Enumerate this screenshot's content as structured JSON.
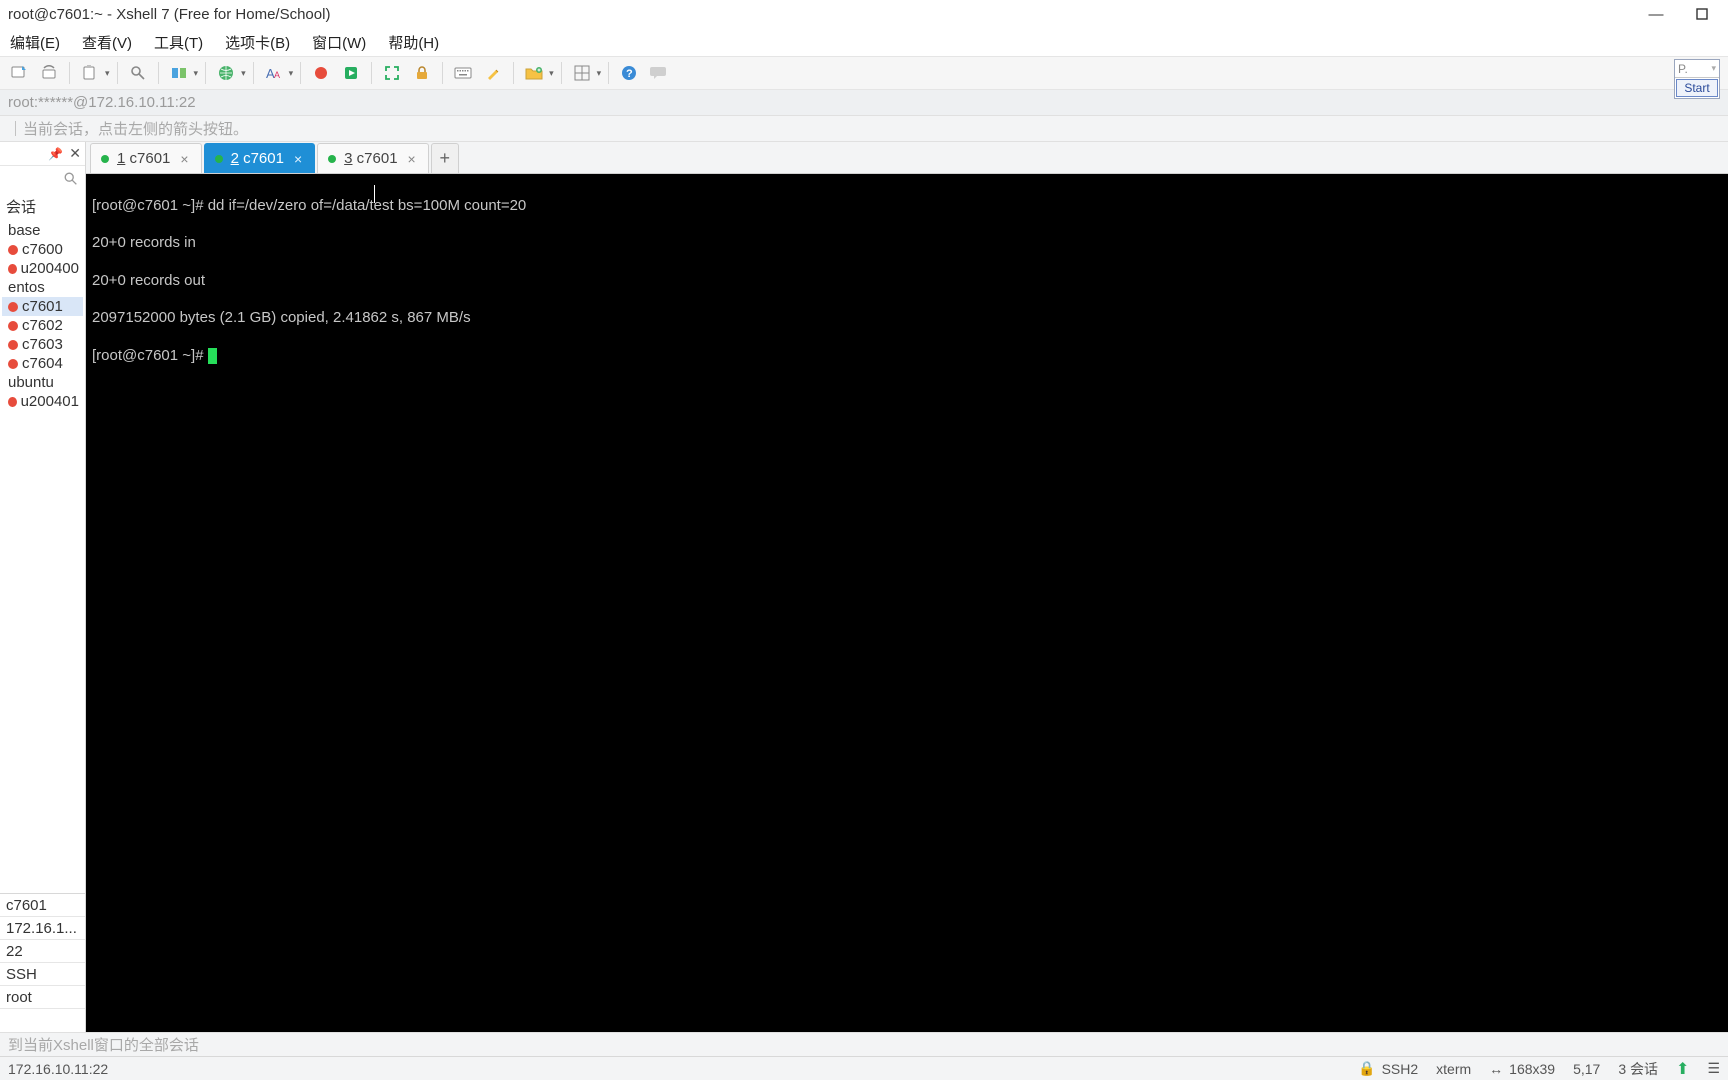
{
  "title": "root@c7601:~ - Xshell 7 (Free for Home/School)",
  "menu": {
    "edit": "编辑(E)",
    "view": "查看(V)",
    "tools": "工具(T)",
    "tabs": "选项卡(B)",
    "window": "窗口(W)",
    "help": "帮助(H)"
  },
  "addr": "root:******@172.16.10.11:22",
  "hint": "｜当前会话，点击左侧的箭头按钮。",
  "start_panel": {
    "row": "P.",
    "button": "Start"
  },
  "sidebar": {
    "title": "会话",
    "groups": {
      "base": "base",
      "centos": "entos",
      "ubuntu": "ubuntu"
    },
    "items_base": [
      {
        "name": "c7600",
        "dot": "red"
      },
      {
        "name": "u200400",
        "dot": "red"
      }
    ],
    "items_centos": [
      {
        "name": "c7601",
        "dot": "red",
        "selected": true
      },
      {
        "name": "c7602",
        "dot": "red"
      },
      {
        "name": "c7603",
        "dot": "red"
      },
      {
        "name": "c7604",
        "dot": "red"
      }
    ],
    "items_ubuntu": [
      {
        "name": "u200401",
        "dot": "red"
      }
    ],
    "props": {
      "name": "c7601",
      "host": "172.16.1...",
      "port": "22",
      "protocol": "SSH",
      "user": "root"
    }
  },
  "tabs": [
    {
      "num": "1",
      "label": "c7601",
      "active": false
    },
    {
      "num": "2",
      "label": "c7601",
      "active": true
    },
    {
      "num": "3",
      "label": "c7601",
      "active": false
    }
  ],
  "terminal": {
    "lines": [
      "[root@c7601 ~]# dd if=/dev/zero of=/data/test bs=100M count=20",
      "20+0 records in",
      "20+0 records out",
      "2097152000 bytes (2.1 GB) copied, 2.41862 s, 867 MB/s",
      "[root@c7601 ~]# "
    ]
  },
  "echo": "﻿﻿﻿﻿﻿﻿﻿﻿﻿﻿﻿﻿﻿﻿﻿到当前Xshell窗口的全部会话",
  "status": {
    "addr": "172.16.10.11:22",
    "proto": "SSH2",
    "termtype": "xterm",
    "size": "168x39",
    "cursor": "5,17",
    "sessions_label": "3 会话"
  }
}
